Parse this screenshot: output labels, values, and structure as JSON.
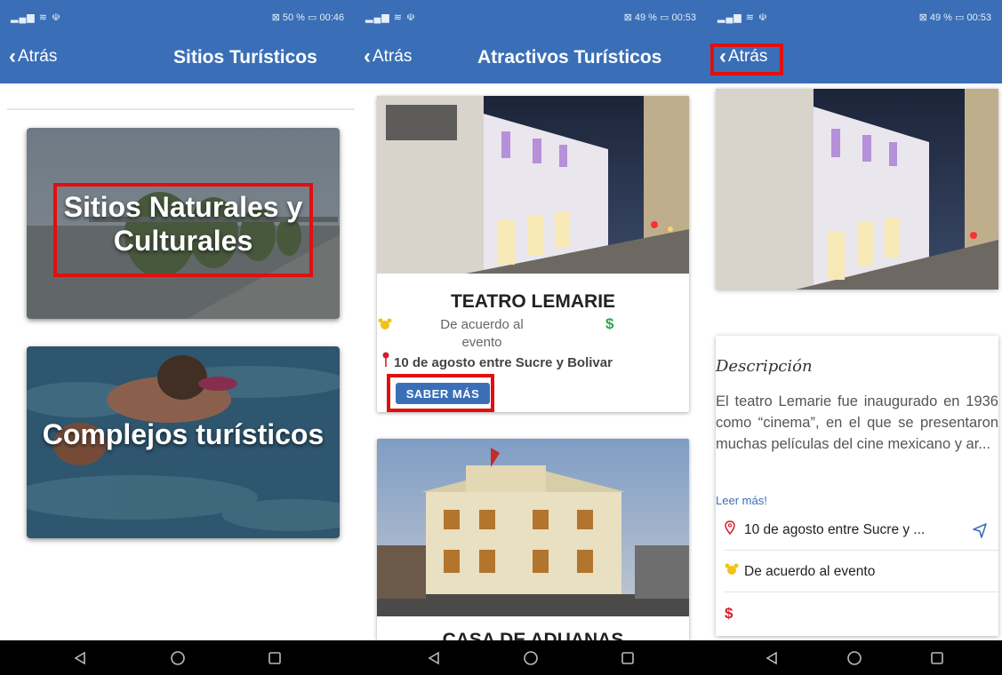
{
  "screens": [
    {
      "status_left": "▂▄▆ ≋ ☫",
      "status_right": "⊠ 50 % ▭ 00:46",
      "back": "Atrás",
      "title": "Sitios Turísticos",
      "categories": [
        "Sitios Naturales y Culturales",
        "Complejos turísticos"
      ]
    },
    {
      "status_left": "▂▄▆ ≋ ☫",
      "status_right": "⊠ 49 % ▭ 00:53",
      "back": "Atrás",
      "title": "Atractivos Turísticos",
      "card": {
        "name": "TEATRO LEMARIE",
        "hours": "De acuerdo al evento",
        "price": "$",
        "address": "10 de agosto entre Sucre y Bolivar",
        "button": "SABER MÁS"
      },
      "next_card_title": "CASA DE ADUANAS"
    },
    {
      "status_left": "▂▄▆ ≋ ☫",
      "status_right": "⊠ 49 % ▭ 00:53",
      "back": "Atrás",
      "desc_heading": "Descripción",
      "description": "El teatro Lemarie fue inaugurado en 1936 como “cinema”, en el que se presentaron muchas películas del cine mexicano y ar...",
      "read_more": "Leer más!",
      "address": "10 de agosto entre Sucre y ...",
      "hours": "De acuerdo al evento",
      "price": "$"
    }
  ],
  "icons": {
    "back": "chevron-left-icon",
    "alarm": "alarm-clock-icon",
    "pin": "location-pin-icon",
    "navigate": "navigation-arrow-icon",
    "nav_back": "triangle-back-icon",
    "nav_home": "circle-home-icon",
    "nav_recents": "square-recents-icon"
  },
  "colors": {
    "primary": "#3a6fb7",
    "highlight": "#e10f0f",
    "price_green": "#2aa84a",
    "price_red": "#d0202a",
    "alarm_yellow": "#f2c21b"
  }
}
